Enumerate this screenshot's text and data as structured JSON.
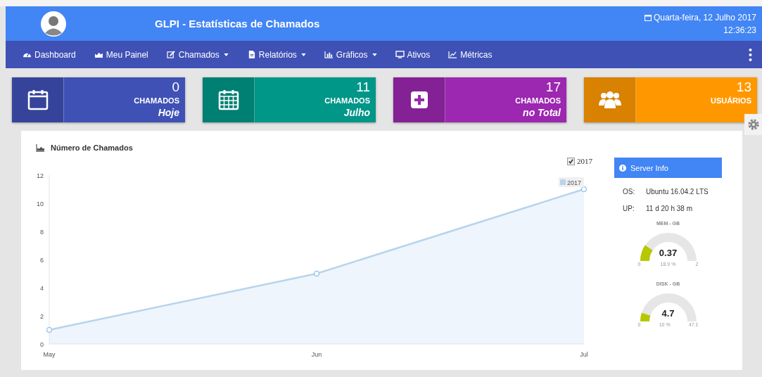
{
  "header": {
    "title": "GLPI - Estatísticas de Chamados",
    "date": "Quarta-feira, 12 Julho 2017",
    "time": "12:36:23"
  },
  "nav": [
    {
      "label": "Dashboard",
      "dropdown": false
    },
    {
      "label": "Meu Painel",
      "dropdown": false
    },
    {
      "label": "Chamados",
      "dropdown": true
    },
    {
      "label": "Relatórios",
      "dropdown": true
    },
    {
      "label": "Gráficos",
      "dropdown": true
    },
    {
      "label": "Ativos",
      "dropdown": false
    },
    {
      "label": "Métricas",
      "dropdown": false
    }
  ],
  "stats": [
    {
      "value": "0",
      "label": "CHAMADOS",
      "sub": "Hoje",
      "color": "#3f51b5"
    },
    {
      "value": "11",
      "label": "CHAMADOS",
      "sub": "Julho",
      "color": "#009688"
    },
    {
      "value": "17",
      "label": "CHAMADOS",
      "sub": "no Total",
      "color": "#9c27b0"
    },
    {
      "value": "13",
      "label": "USUÁRIOS",
      "color": "#ff9800"
    }
  ],
  "panel": {
    "title": "Número de Chamados",
    "legend": {
      "label": "2017",
      "checked": true
    },
    "chart_data": {
      "type": "area",
      "categories": [
        "May",
        "Jun",
        "Jul"
      ],
      "ylim": [
        0,
        12
      ],
      "yticks": [
        0,
        2,
        4,
        6,
        8,
        10,
        12
      ],
      "series": [
        {
          "name": "2017",
          "color": "#b8d4ec",
          "values": [
            1,
            5,
            11
          ]
        }
      ]
    }
  },
  "server": {
    "title": "Server Info",
    "rows": [
      {
        "key": "OS:",
        "value": "Ubuntu 16.04.2 LTS"
      },
      {
        "key": "UP:",
        "value": "11 d 20 h 38 m"
      }
    ],
    "gauges": [
      {
        "title": "MEM - GB",
        "value": "0.37",
        "percent": "18.9 %",
        "min": "0",
        "max": "2"
      },
      {
        "title": "DISK - GB",
        "value": "4.7",
        "percent": "10 %",
        "min": "0",
        "max": "47.1"
      }
    ]
  }
}
